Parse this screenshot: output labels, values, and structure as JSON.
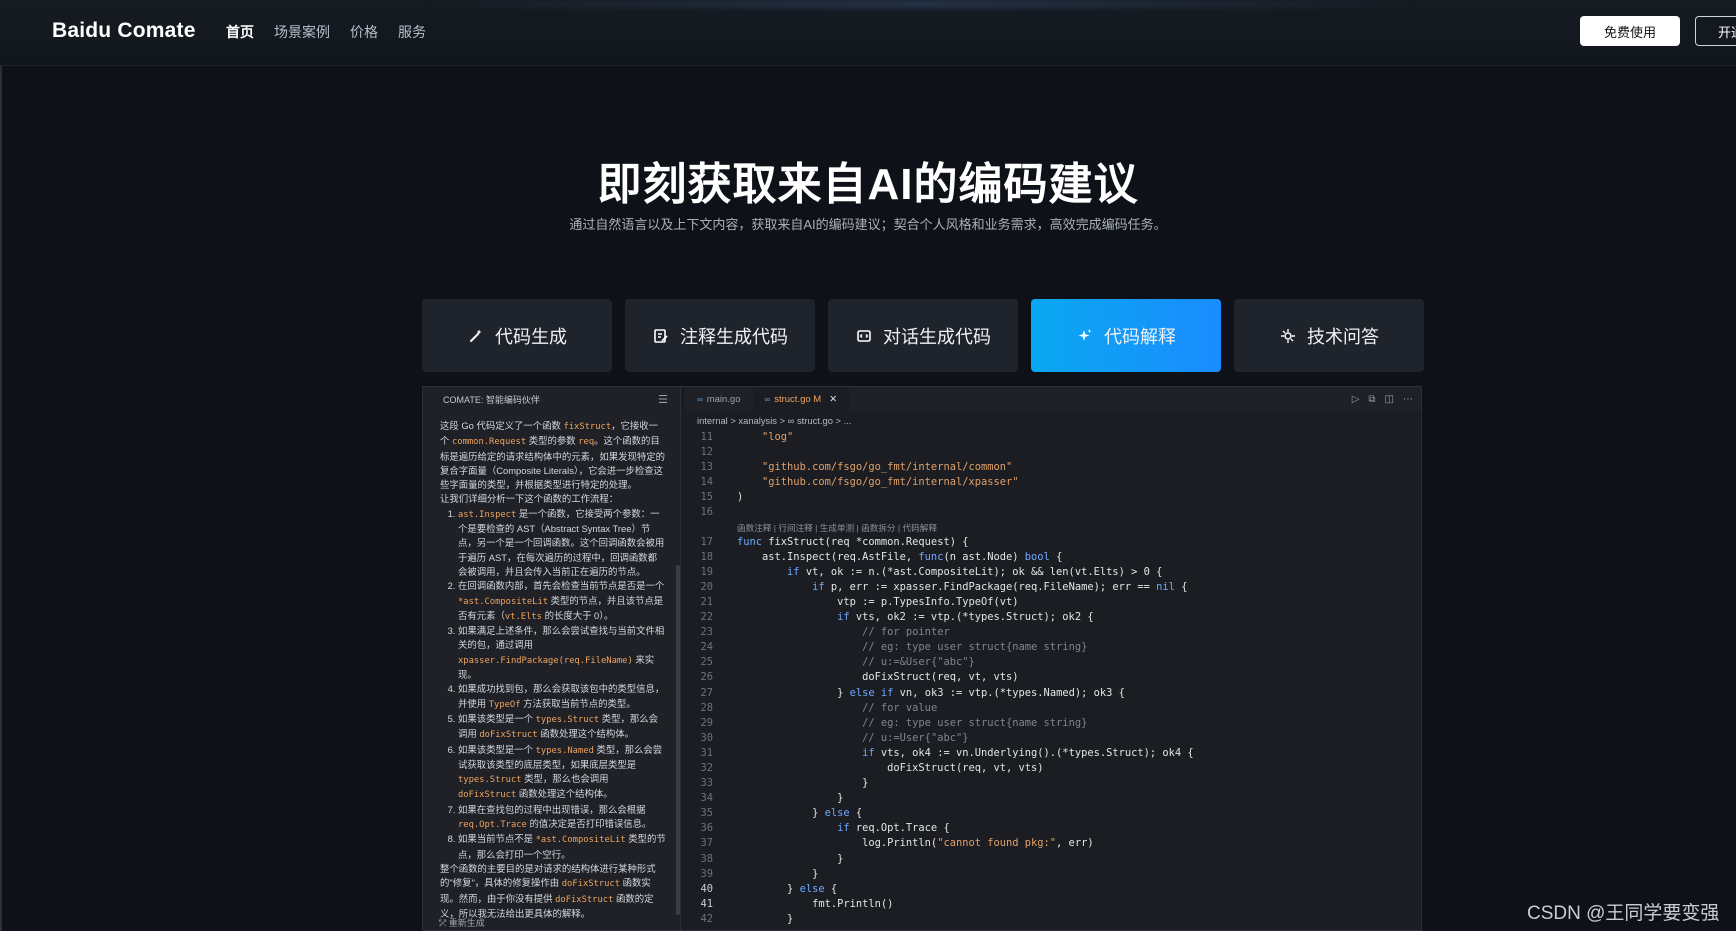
{
  "header": {
    "logo": "Baidu Comate",
    "nav": [
      "首页",
      "场景案例",
      "价格",
      "服务"
    ],
    "free_button": "免费使用",
    "open_button": "开通"
  },
  "hero": {
    "title": "即刻获取来自AI的编码建议",
    "subtitle": "通过自然语言以及上下文内容，获取来自AI的编码建议；契合个人风格和业务需求，高效完成编码任务。"
  },
  "tabs": [
    {
      "label": "代码生成",
      "icon": "wand-icon"
    },
    {
      "label": "注释生成代码",
      "icon": "comment-edit-icon"
    },
    {
      "label": "对话生成代码",
      "icon": "chat-code-icon"
    },
    {
      "label": "代码解释",
      "icon": "sparkle-icon"
    },
    {
      "label": "技术问答",
      "icon": "question-icon"
    }
  ],
  "chat": {
    "title": "COMATE: 智能编码伙伴",
    "intro": [
      {
        "t": "这段 Go 代码定义了一个函数 "
      },
      {
        "c": "fixStruct"
      },
      {
        "t": "，它接收一个 "
      },
      {
        "c": "common.Request"
      },
      {
        "t": " 类型的参数 "
      },
      {
        "c": "req"
      },
      {
        "t": "。这个函数的目标是遍历给定的请求结构体中的元素，如果发现特定的复合字面量（Composite Literals），它会进一步检查这些字面量的类型，并根据类型进行特定的处理。"
      }
    ],
    "intro2": "让我们详细分析一下这个函数的工作流程：",
    "steps": [
      [
        {
          "c": "ast.Inspect"
        },
        {
          "t": " 是一个函数，它接受两个参数：一个是要检查的 AST（Abstract Syntax Tree）节点，另一个是一个回调函数。这个回调函数会被用于遍历 AST，在每次遍历的过程中，回调函数都会被调用，并且会传入当前正在遍历的节点。"
        }
      ],
      [
        {
          "t": "在回调函数内部，首先会检查当前节点是否是一个 "
        },
        {
          "c": "*ast.CompositeLit"
        },
        {
          "t": " 类型的节点，并且该节点是否有元素（"
        },
        {
          "c": "vt.Elts"
        },
        {
          "t": " 的长度大于 0）。"
        }
      ],
      [
        {
          "t": "如果满足上述条件，那么会尝试查找与当前文件相关的包，通过调用 "
        },
        {
          "c": "xpasser.FindPackage(req.FileName)"
        },
        {
          "t": " 来实现。"
        }
      ],
      [
        {
          "t": "如果成功找到包，那么会获取该包中的类型信息，并使用 "
        },
        {
          "c": "TypeOf"
        },
        {
          "t": " 方法获取当前节点的类型。"
        }
      ],
      [
        {
          "t": "如果该类型是一个 "
        },
        {
          "c": "types.Struct"
        },
        {
          "t": " 类型，那么会调用 "
        },
        {
          "c": "doFixStruct"
        },
        {
          "t": " 函数处理这个结构体。"
        }
      ],
      [
        {
          "t": "如果该类型是一个 "
        },
        {
          "c": "types.Named"
        },
        {
          "t": " 类型，那么会尝试获取该类型的底层类型，如果底层类型是 "
        },
        {
          "c": "types.Struct"
        },
        {
          "t": " 类型，那么也会调用 "
        },
        {
          "c": "doFixStruct"
        },
        {
          "t": " 函数处理这个结构体。"
        }
      ],
      [
        {
          "t": "如果在查找包的过程中出现错误，那么会根据 "
        },
        {
          "c": "req.Opt.Trace"
        },
        {
          "t": " 的值决定是否打印错误信息。"
        }
      ],
      [
        {
          "t": "如果当前节点不是 "
        },
        {
          "c": "*ast.CompositeLit"
        },
        {
          "t": " 类型的节点，那么会打印一个空行。"
        }
      ]
    ],
    "summary": [
      {
        "t": "整个函数的主要目的是对请求的结构体进行某种形式的\"修复\"，具体的修复操作由 "
      },
      {
        "c": "doFixStruct"
      },
      {
        "t": " 函数实现。然而，由于你没有提供 "
      },
      {
        "c": "doFixStruct"
      },
      {
        "t": " 函数的定义，所以我无法给出更具体的解释。"
      }
    ],
    "regenerate": "重新生成"
  },
  "editor": {
    "tabs": [
      {
        "label": "main.go",
        "active": false
      },
      {
        "label": "struct.go M",
        "active": true
      }
    ],
    "breadcrumb": "internal  >  xanalysis  >  ∞ struct.go  >  ...",
    "codelens": "函数注释 | 行间注释 | 生成单测 | 函数拆分 | 代码解释",
    "lines": [
      {
        "n": 11,
        "code": "    \"log\""
      },
      {
        "n": 12,
        "code": ""
      },
      {
        "n": 13,
        "code": "    \"github.com/fsgo/go_fmt/internal/common\""
      },
      {
        "n": 14,
        "code": "    \"github.com/fsgo/go_fmt/internal/xpasser\""
      },
      {
        "n": 15,
        "code": ")"
      },
      {
        "n": 16,
        "code": ""
      },
      {
        "n": 17,
        "code": "func fixStruct(req *common.Request) {"
      },
      {
        "n": 18,
        "code": "    ast.Inspect(req.AstFile, func(n ast.Node) bool {"
      },
      {
        "n": 19,
        "code": "        if vt, ok := n.(*ast.CompositeLit); ok && len(vt.Elts) > 0 {"
      },
      {
        "n": 20,
        "code": "            if p, err := xpasser.FindPackage(req.FileName); err == nil {"
      },
      {
        "n": 21,
        "code": "                vtp := p.TypesInfo.TypeOf(vt)"
      },
      {
        "n": 22,
        "code": "                if vts, ok2 := vtp.(*types.Struct); ok2 {"
      },
      {
        "n": 23,
        "code": "                    // for pointer"
      },
      {
        "n": 24,
        "code": "                    // eg: type user struct{name string}"
      },
      {
        "n": 25,
        "code": "                    // u:=&User{\"abc\"}"
      },
      {
        "n": 26,
        "code": "                    doFixStruct(req, vt, vts)"
      },
      {
        "n": 27,
        "code": "                } else if vn, ok3 := vtp.(*types.Named); ok3 {"
      },
      {
        "n": 28,
        "code": "                    // for value"
      },
      {
        "n": 29,
        "code": "                    // eg: type user struct{name string}"
      },
      {
        "n": 30,
        "code": "                    // u:=User{\"abc\"}"
      },
      {
        "n": 31,
        "code": "                    if vts, ok4 := vn.Underlying().(*types.Struct); ok4 {"
      },
      {
        "n": 32,
        "code": "                        doFixStruct(req, vt, vts)"
      },
      {
        "n": 33,
        "code": "                    }"
      },
      {
        "n": 34,
        "code": "                }"
      },
      {
        "n": 35,
        "code": "            } else {"
      },
      {
        "n": 36,
        "code": "                if req.Opt.Trace {"
      },
      {
        "n": 37,
        "code": "                    log.Println(\"cannot found pkg:\", err)"
      },
      {
        "n": 38,
        "code": "                }"
      },
      {
        "n": 39,
        "code": "            }"
      },
      {
        "n": 40,
        "code": "        } else {"
      },
      {
        "n": 41,
        "code": "            fmt.Println()"
      },
      {
        "n": 42,
        "code": "        }"
      }
    ]
  },
  "watermark": "CSDN @王同学要变强",
  "colors": {
    "accent": "#1a8cff",
    "code_string": "#e0a16a",
    "code_keyword": "#6ea8ff",
    "code_comment": "#7f8590"
  }
}
